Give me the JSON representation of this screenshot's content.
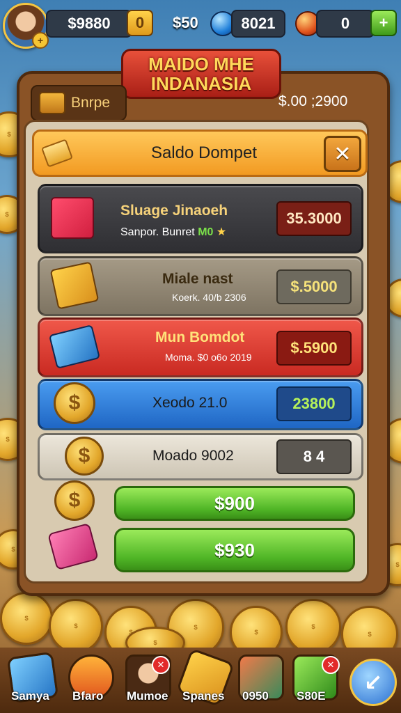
{
  "top_bar": {
    "coins": "$9880",
    "coin_button": "0",
    "cash": "$50",
    "gems": "8021",
    "energy": "0",
    "add": "+"
  },
  "title": {
    "line1": "MAIDO MHE",
    "line2": "INDANASIA"
  },
  "panel": {
    "tab_label": "Bnrpe",
    "balance": "$.00 ;2900",
    "header_title": "Saldo Dompet",
    "close": "✕"
  },
  "rows": [
    {
      "name": "Sluage Jinaoeh",
      "sub": "Sanpor. Bunret",
      "sub_badge": "M0",
      "value": "35.3000"
    },
    {
      "name": "Miale nast",
      "sub": "Koerk. 40/b 2306",
      "value": "$.5000"
    },
    {
      "name": "Mun Bomdot",
      "sub": "Moma. $0 o6o 2019",
      "value": "$.5900"
    },
    {
      "name": "Xeodo 21.0",
      "value": "23800"
    },
    {
      "name": "Moado 9002",
      "value": "8 4"
    }
  ],
  "buttons": {
    "first": "$900",
    "second": "$930"
  },
  "nav": [
    {
      "label": "Samya",
      "icon": "card-icon"
    },
    {
      "label": "Bfaro",
      "icon": "ring-icon"
    },
    {
      "label": "Mumoe",
      "icon": "avatar-icon"
    },
    {
      "label": "Spanes",
      "icon": "gold-bar-icon"
    },
    {
      "label": "0950",
      "icon": "map-icon"
    },
    {
      "label": "S80E",
      "icon": "cash-icon"
    },
    {
      "label": "",
      "icon": "arrow-icon"
    }
  ],
  "colors": {
    "accent": "#f29a22",
    "green": "#4fb526",
    "panel": "#8a5326"
  }
}
